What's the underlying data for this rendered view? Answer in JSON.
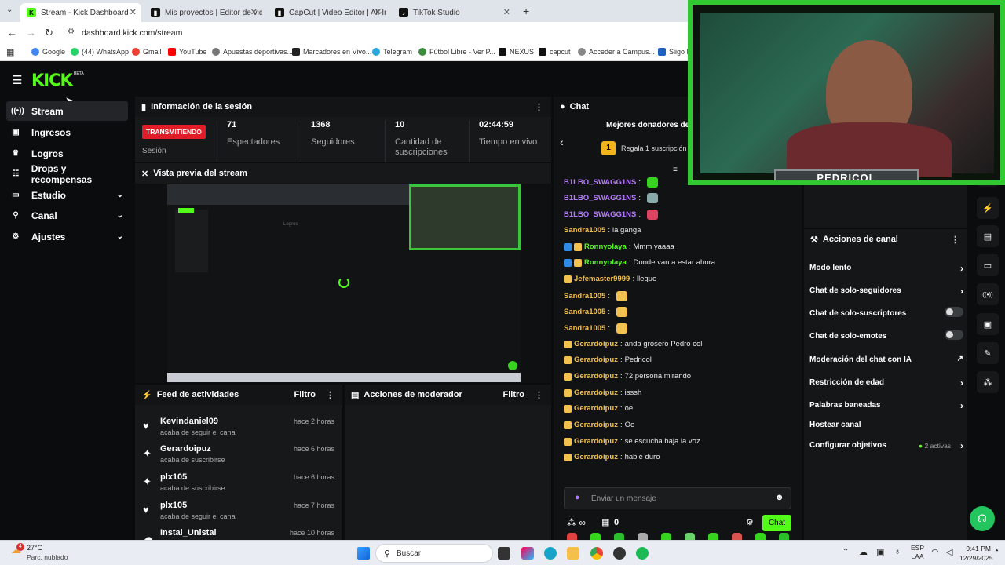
{
  "browser": {
    "tabs": [
      {
        "title": "Stream - Kick Dashboard",
        "active": true
      },
      {
        "title": "Mis proyectos | Editor de video",
        "active": false
      },
      {
        "title": "CapCut | Video Editor | All-In-O",
        "active": false
      },
      {
        "title": "TikTok Studio",
        "active": false
      }
    ],
    "new_tab": "+",
    "url": "dashboard.kick.com/stream",
    "bookmarks": [
      "Google",
      "(44) WhatsApp",
      "Gmail",
      "YouTube",
      "Apuestas deportivas...",
      "Marcadores en Vivo...",
      "Telegram",
      "Fútbol Libre - Ver P...",
      "NEXUS",
      "capcut",
      "Acceder a Campus...",
      "Siigo F"
    ]
  },
  "brand": {
    "logo": "KICK",
    "beta": "BETA",
    "accent": "#53fc18"
  },
  "sidebar": {
    "items": [
      {
        "label": "Stream",
        "icon": "broadcast-icon",
        "active": true
      },
      {
        "label": "Ingresos",
        "icon": "money-icon"
      },
      {
        "label": "Logros",
        "icon": "trophy-icon"
      },
      {
        "label": "Drops y recompensas",
        "icon": "gift-icon"
      },
      {
        "label": "Estudio",
        "icon": "studio-icon",
        "expandable": true
      },
      {
        "label": "Canal",
        "icon": "channel-icon",
        "expandable": true
      },
      {
        "label": "Ajustes",
        "icon": "gear-icon",
        "expandable": true
      }
    ]
  },
  "session": {
    "title": "Información de la sesión",
    "live_badge": "TRANSMITIENDO",
    "session_label": "Sesión",
    "stats": [
      {
        "value": "71",
        "label": "Espectadores"
      },
      {
        "value": "1368",
        "label": "Seguidores"
      },
      {
        "value": "10",
        "label": "Cantidad de suscripciones"
      },
      {
        "value": "02:44:59",
        "label": "Tiempo en vivo"
      }
    ]
  },
  "preview": {
    "title": "Vista previa del stream",
    "inner_text": "Logros"
  },
  "activity": {
    "title": "Feed de actividades",
    "filter": "Filtro",
    "items": [
      {
        "name": "Kevindaniel09",
        "desc": "acaba de seguir el canal",
        "time": "hace 2 horas",
        "icon": "heart-icon"
      },
      {
        "name": "Gerardoipuz",
        "desc": "acaba de suscribirse",
        "time": "hace 6 horas",
        "icon": "sparkle-icon"
      },
      {
        "name": "plx105",
        "desc": "acaba de suscribirse",
        "time": "hace 6 horas",
        "icon": "sparkle-icon"
      },
      {
        "name": "plx105",
        "desc": "acaba de seguir el canal",
        "time": "hace 7 horas",
        "icon": "heart-icon"
      },
      {
        "name": "Instal_Unistal",
        "desc": "",
        "time": "hace 10 horas",
        "icon": "cloud-icon"
      }
    ]
  },
  "moderator": {
    "title": "Acciones de moderador",
    "filter": "Filtro"
  },
  "chat": {
    "title": "Chat",
    "top_donors": "Mejores donadores de",
    "gift_rank": "1",
    "gift_text": "Regala 1 suscripción p",
    "messages": [
      {
        "user": "B1LBO_SWAGG1NS",
        "text": "",
        "color": "#b57bff"
      },
      {
        "user": "B1LBO_SWAGG1NS",
        "text": "",
        "color": "#b57bff"
      },
      {
        "user": "B1LBO_SWAGG1NS",
        "text": "",
        "color": "#b57bff"
      },
      {
        "user": "Sandra1005",
        "text": "la ganga",
        "color": "#f2c14e"
      },
      {
        "user": "Ronnyolaya",
        "text": "Mmm yaaaa",
        "color": "#53fc18"
      },
      {
        "user": "Ronnyolaya",
        "text": "Donde van a estar ahora",
        "color": "#53fc18"
      },
      {
        "user": "Jefemaster9999",
        "text": "llegue",
        "color": "#f2c14e"
      },
      {
        "user": "Sandra1005",
        "text": "",
        "color": "#f2c14e"
      },
      {
        "user": "Sandra1005",
        "text": "",
        "color": "#f2c14e"
      },
      {
        "user": "Sandra1005",
        "text": "",
        "color": "#f2c14e"
      },
      {
        "user": "Gerardoipuz",
        "text": "anda grosero Pedro col",
        "color": "#f2c14e"
      },
      {
        "user": "Gerardoipuz",
        "text": "Pedricol",
        "color": "#f2c14e"
      },
      {
        "user": "Gerardoipuz",
        "text": "72 persona mirando",
        "color": "#f2c14e"
      },
      {
        "user": "Gerardoipuz",
        "text": "isssh",
        "color": "#f2c14e"
      },
      {
        "user": "Gerardoipuz",
        "text": "oe",
        "color": "#f2c14e"
      },
      {
        "user": "Gerardoipuz",
        "text": "Oe",
        "color": "#f2c14e"
      },
      {
        "user": "Gerardoipuz",
        "text": "se escucha baja la voz",
        "color": "#f2c14e"
      },
      {
        "user": "Gerardoipuz",
        "text": "hablé duro",
        "color": "#f2c14e"
      }
    ],
    "input_placeholder": "Enviar un mensaje",
    "points": "0",
    "send": "Chat"
  },
  "channel_actions": {
    "title": "Acciones de canal",
    "items": [
      {
        "label": "Modo lento",
        "type": "arrow"
      },
      {
        "label": "Chat de solo-seguidores",
        "type": "arrow"
      },
      {
        "label": "Chat de solo-suscriptores",
        "type": "toggle"
      },
      {
        "label": "Chat de solo-emotes",
        "type": "toggle"
      },
      {
        "label": "Moderación del chat con IA",
        "type": "external"
      },
      {
        "label": "Restricción de edad",
        "type": "arrow"
      },
      {
        "label": "Palabras baneadas",
        "type": "arrow"
      },
      {
        "label": "Hostear canal",
        "type": "none"
      },
      {
        "label": "Configurar objetivos",
        "type": "arrow",
        "extra": "2 activas"
      }
    ]
  },
  "webcam": {
    "name": "PEDRICOL"
  },
  "taskbar": {
    "weather_temp": "27°C",
    "weather_desc": "Parc. nublado",
    "weather_badge": "4",
    "search": "Buscar",
    "lang1": "ESP",
    "lang2": "LAA",
    "time": "9:41 PM",
    "date": "12/29/2025"
  }
}
